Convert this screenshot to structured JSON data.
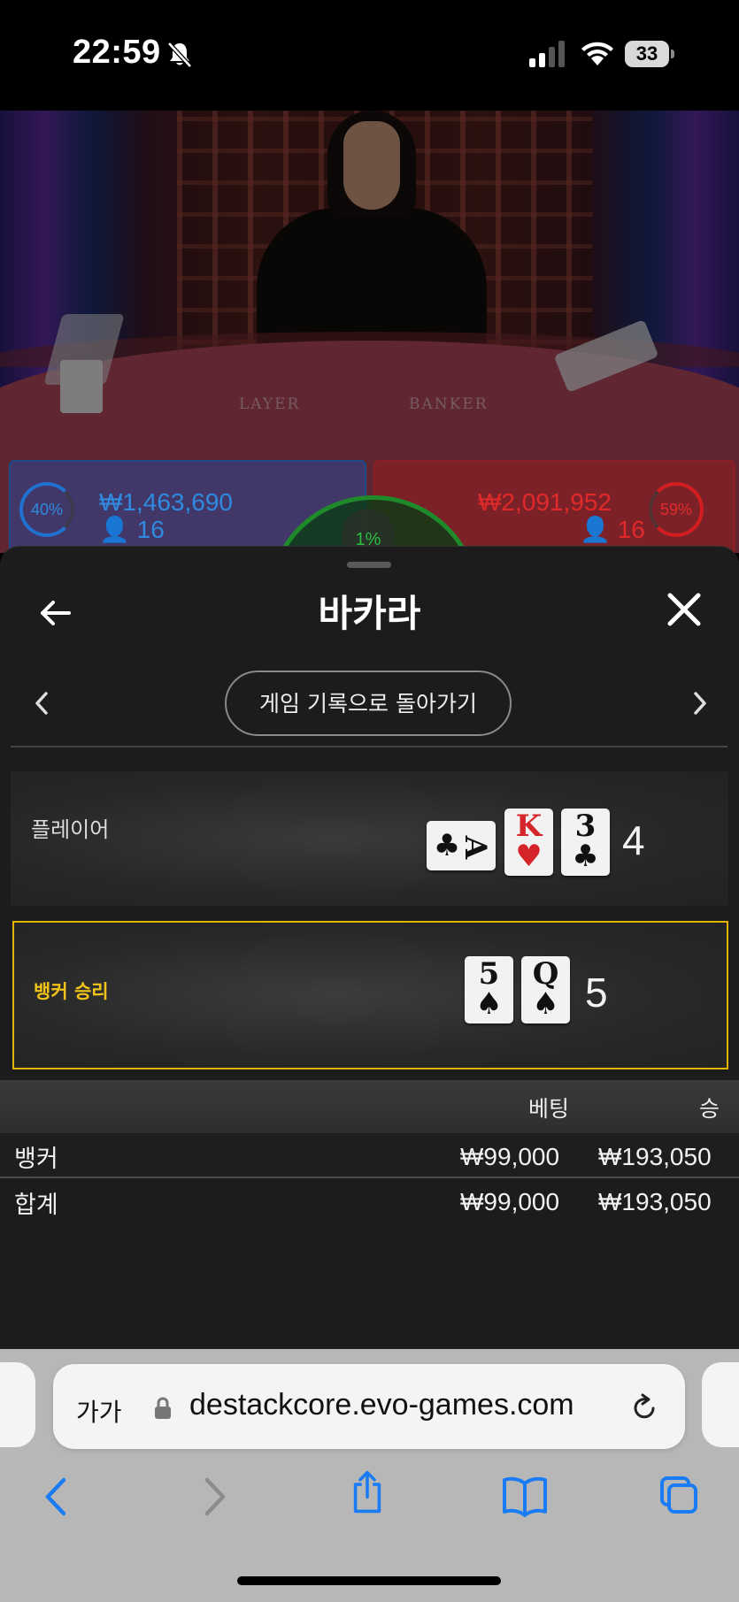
{
  "status_bar": {
    "time": "22:59",
    "battery": "33"
  },
  "game": {
    "table_labels": {
      "player": "LAYER",
      "banker": "BANKER"
    },
    "player_stats": {
      "percent": "40%",
      "amount": "₩1,463,690",
      "count": "16"
    },
    "banker_stats": {
      "percent": "59%",
      "amount": "₩2,091,952",
      "count": "16"
    },
    "tie_stats": {
      "percent": "1%"
    }
  },
  "sheet": {
    "title": "바카라",
    "history_button": "게임 기록으로 돌아가기",
    "player": {
      "label": "플레이어",
      "cards": [
        {
          "rank": "A",
          "suit": "♣",
          "color": "black"
        },
        {
          "rank": "K",
          "suit": "♥",
          "color": "red"
        },
        {
          "rank": "3",
          "suit": "♣",
          "color": "black"
        }
      ],
      "score": "4"
    },
    "banker": {
      "label": "뱅커 승리",
      "cards": [
        {
          "rank": "5",
          "suit": "♠",
          "color": "black"
        },
        {
          "rank": "Q",
          "suit": "♠",
          "color": "black"
        }
      ],
      "score": "5"
    },
    "bets_table": {
      "headers": {
        "bet": "베팅",
        "win": "승"
      },
      "rows": [
        {
          "label": "뱅커",
          "bet": "₩99,000",
          "win": "₩193,050"
        },
        {
          "label": "합계",
          "bet": "₩99,000",
          "win": "₩193,050"
        }
      ]
    }
  },
  "browser": {
    "text_size_button": "가가",
    "url": "destackcore.evo-games.com",
    "accent_color": "#1a7cf5"
  },
  "colors": {
    "win_highlight": "#e0b400",
    "player_blue": "#2f8ae0",
    "banker_red": "#e02a2a",
    "tie_green": "#2bbd40"
  }
}
